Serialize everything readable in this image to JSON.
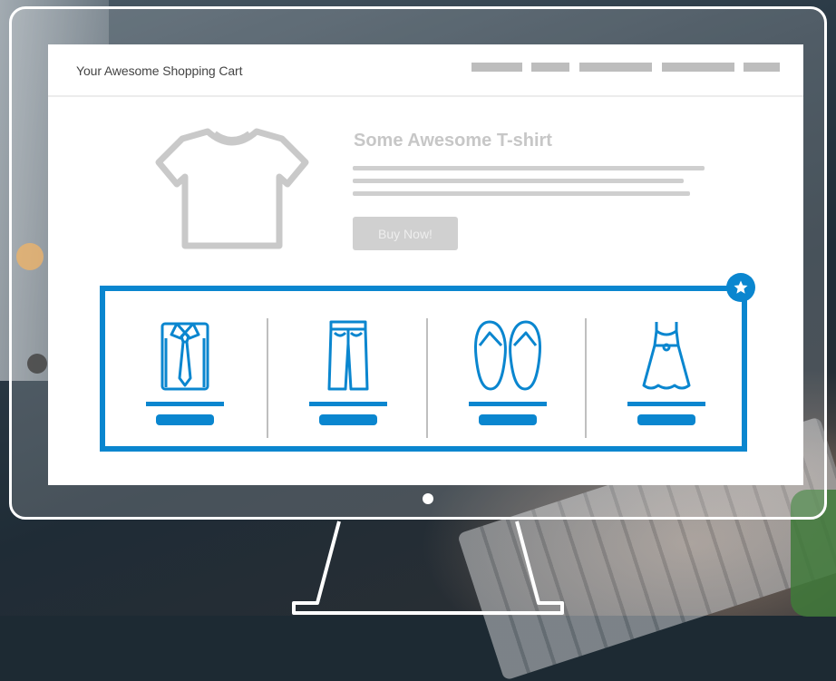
{
  "site": {
    "title": "Your Awesome Shopping Cart"
  },
  "nav": {
    "items": [
      "menu-link-1",
      "menu-link-2",
      "menu-link-3",
      "menu-link-4",
      "menu-link-5"
    ]
  },
  "product": {
    "title": "Some Awesome T-shirt",
    "buy_label": "Buy Now!",
    "icon": "t-shirt-icon"
  },
  "recommendations": {
    "badge_icon": "star-icon",
    "items": [
      {
        "icon": "shirt-and-tie-icon"
      },
      {
        "icon": "pants-icon"
      },
      {
        "icon": "flip-flops-icon"
      },
      {
        "icon": "dress-icon"
      }
    ]
  },
  "colors": {
    "accent": "#0a86cf",
    "placeholder_gray": "#bdbdbd",
    "monitor_outline": "#ffffff"
  }
}
